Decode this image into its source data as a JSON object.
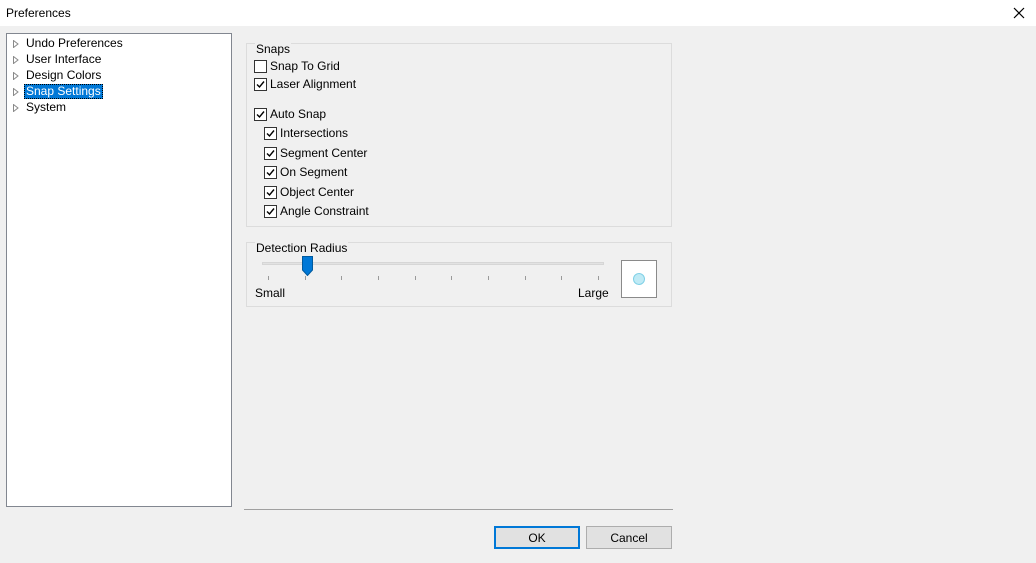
{
  "window": {
    "title": "Preferences"
  },
  "tree": {
    "items": [
      {
        "label": "Undo Preferences",
        "selected": false
      },
      {
        "label": "User Interface",
        "selected": false
      },
      {
        "label": "Design Colors",
        "selected": false
      },
      {
        "label": "Snap Settings",
        "selected": true
      },
      {
        "label": "System",
        "selected": false
      }
    ]
  },
  "snaps": {
    "title": "Snaps",
    "snap_to_grid": {
      "label": "Snap To Grid",
      "checked": false
    },
    "laser_alignment": {
      "label": "Laser Alignment",
      "checked": true
    },
    "auto_snap": {
      "label": "Auto Snap",
      "checked": true
    },
    "intersections": {
      "label": "Intersections",
      "checked": true
    },
    "segment_center": {
      "label": "Segment Center",
      "checked": true
    },
    "on_segment": {
      "label": "On Segment",
      "checked": true
    },
    "object_center": {
      "label": "Object Center",
      "checked": true
    },
    "angle_constraint": {
      "label": "Angle Constraint",
      "checked": true
    }
  },
  "detection_radius": {
    "title": "Detection Radius",
    "min_label": "Small",
    "max_label": "Large",
    "value_fraction": 0.12,
    "tick_count": 10
  },
  "buttons": {
    "ok": "OK",
    "cancel": "Cancel"
  },
  "colors": {
    "selection": "#0078d7",
    "preview_dot": "#bfeaf5"
  }
}
